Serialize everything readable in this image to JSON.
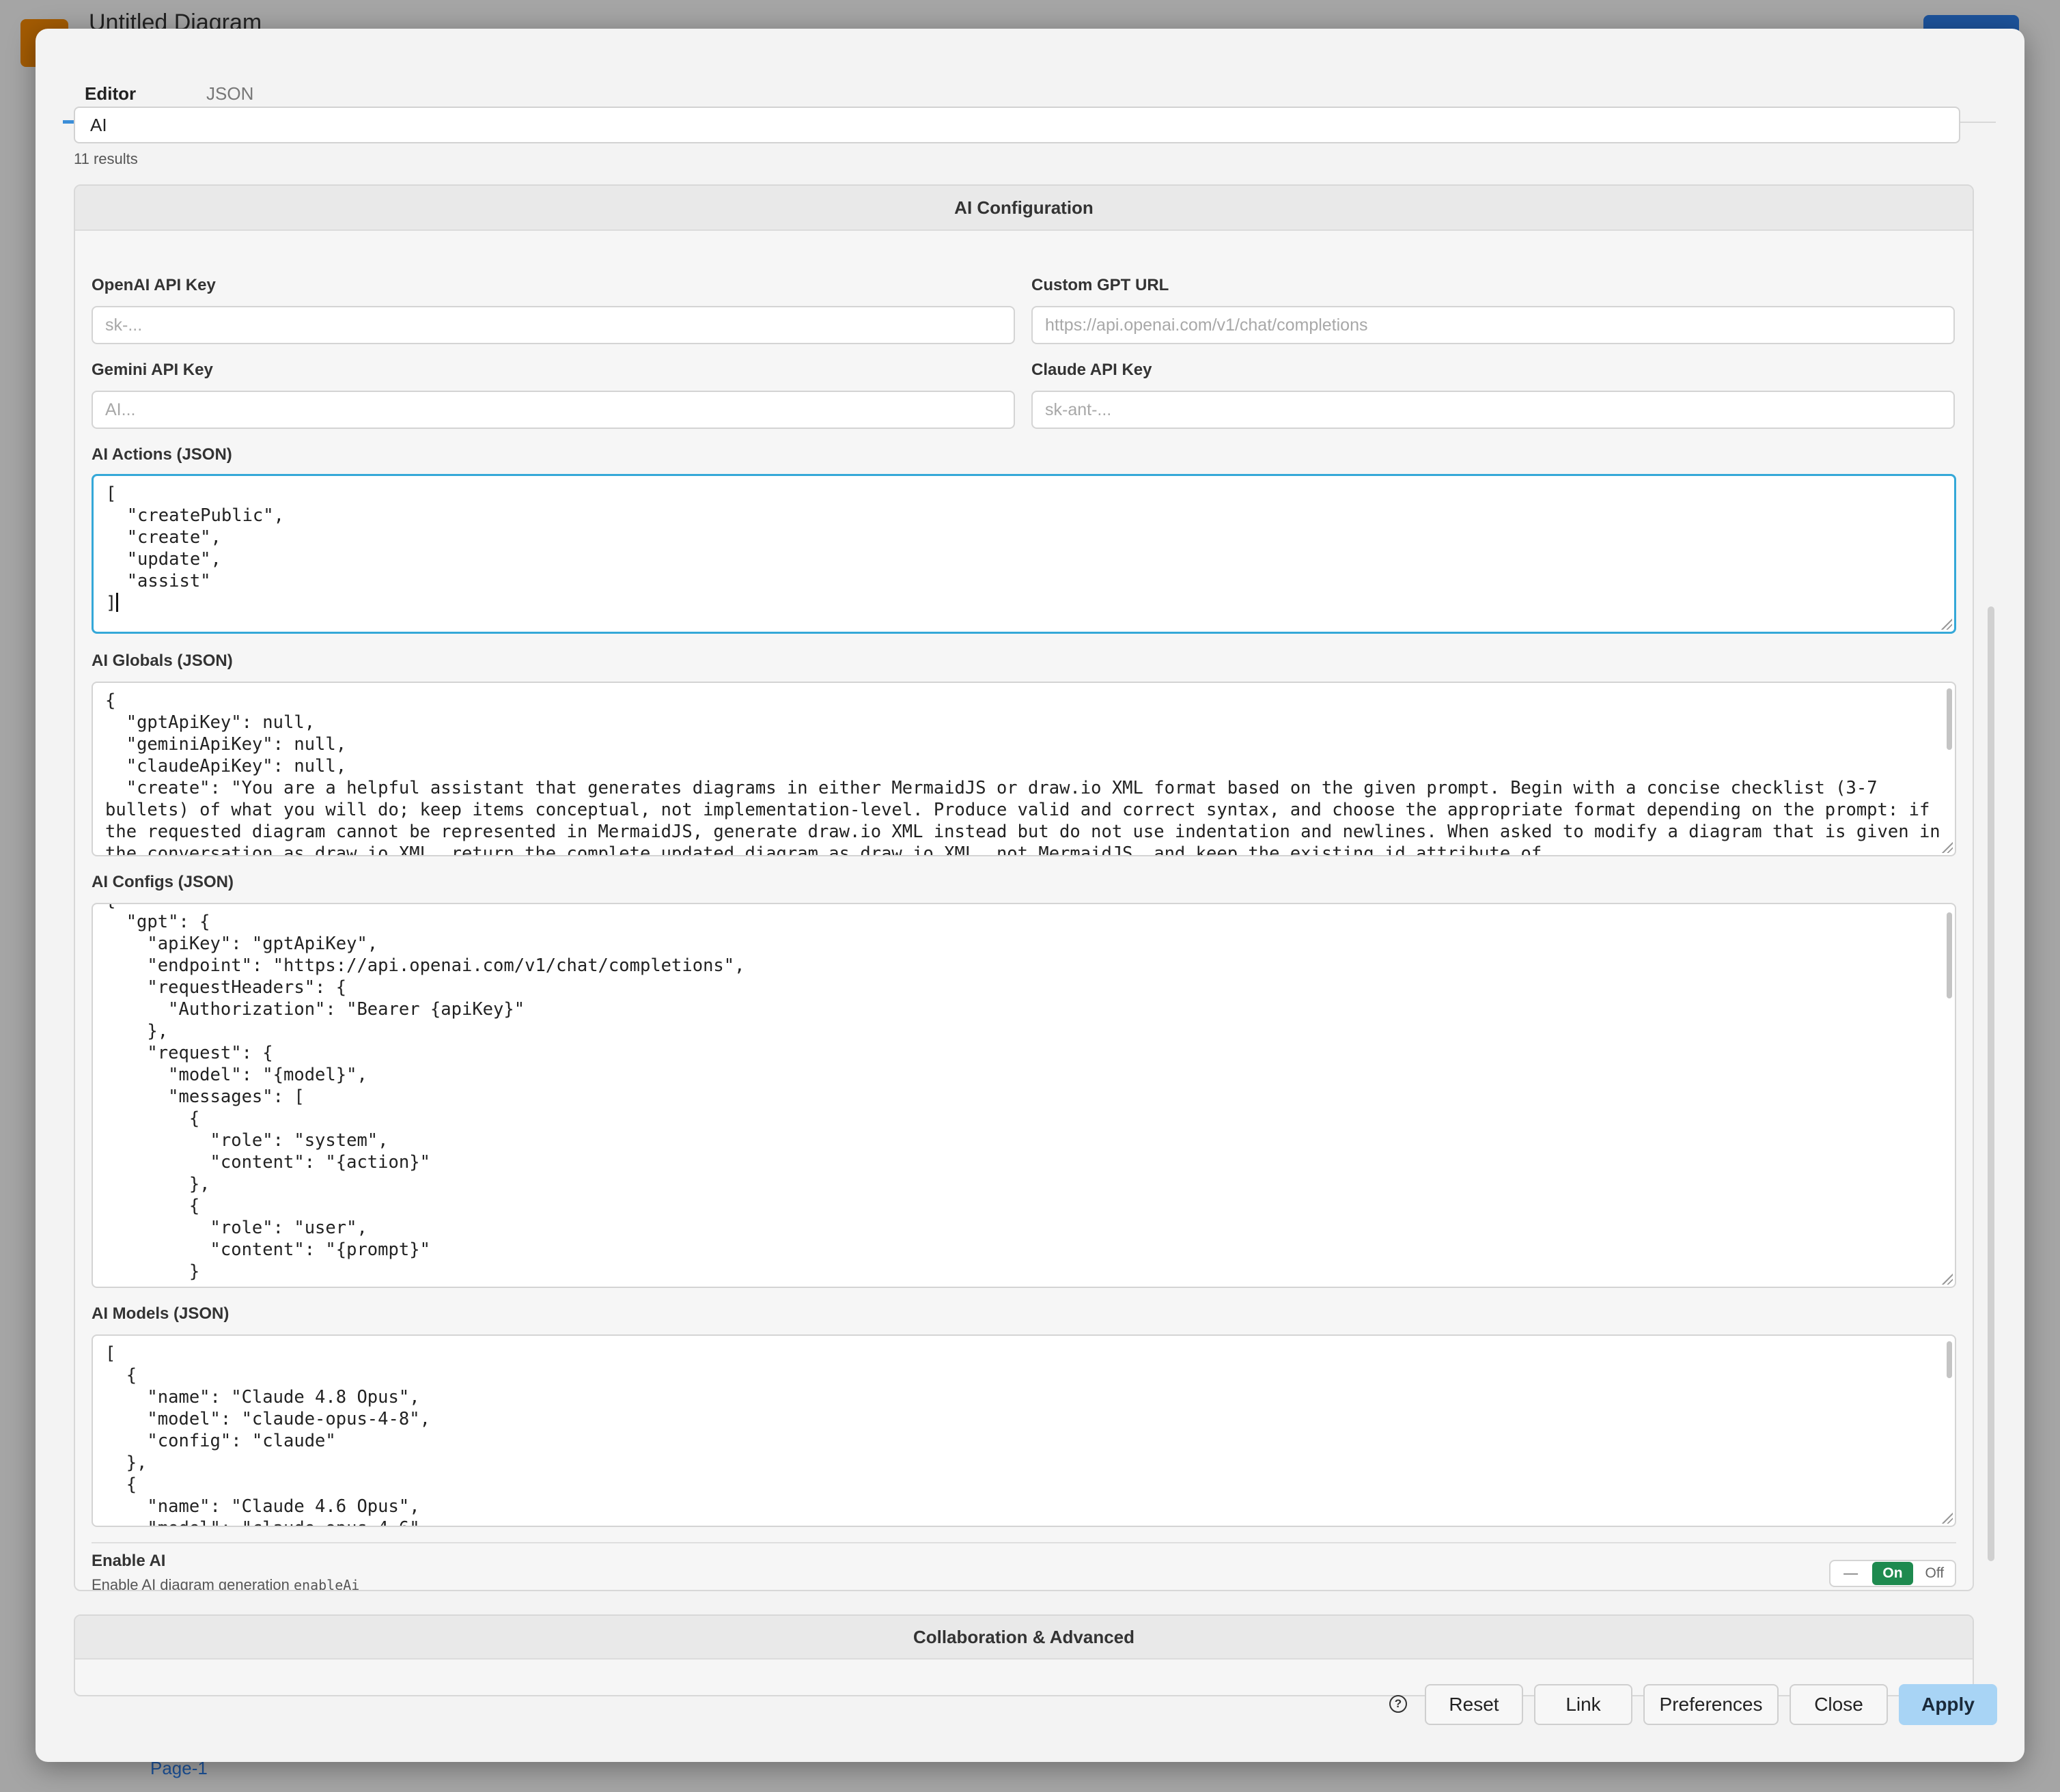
{
  "background": {
    "title": "Untitled Diagram",
    "page_tab": "Page-1"
  },
  "tabs": [
    {
      "label": "Editor",
      "active": true
    },
    {
      "label": "JSON",
      "active": false
    }
  ],
  "search": {
    "value": "AI",
    "results": "11 results"
  },
  "ai_config": {
    "header": "AI Configuration",
    "openai_key": {
      "label": "OpenAI API Key",
      "placeholder": "sk-..."
    },
    "custom_gpt_url": {
      "label": "Custom GPT URL",
      "placeholder": "https://api.openai.com/v1/chat/completions"
    },
    "gemini_key": {
      "label": "Gemini API Key",
      "placeholder": "AI..."
    },
    "claude_key": {
      "label": "Claude API Key",
      "placeholder": "sk-ant-..."
    },
    "actions": {
      "label": "AI Actions (JSON)",
      "value": "[\n  \"createPublic\",\n  \"create\",\n  \"update\",\n  \"assist\"\n]"
    },
    "globals": {
      "label": "AI Globals (JSON)",
      "value": "{\n  \"gptApiKey\": null,\n  \"geminiApiKey\": null,\n  \"claudeApiKey\": null,\n  \"create\": \"You are a helpful assistant that generates diagrams in either MermaidJS or draw.io XML format based on the given prompt. Begin with a concise checklist (3-7 bullets) of what you will do; keep items conceptual, not implementation-level. Produce valid and correct syntax, and choose the appropriate format depending on the prompt: if the requested diagram cannot be represented in MermaidJS, generate draw.io XML instead but do not use indentation and newlines. When asked to modify a diagram that is given in the conversation as draw.io XML, return the complete updated diagram as draw.io XML, not MermaidJS, and keep the existing id attribute of"
    },
    "configs": {
      "label": "AI Configs (JSON)",
      "value": "{\n  \"gpt\": {\n    \"apiKey\": \"gptApiKey\",\n    \"endpoint\": \"https://api.openai.com/v1/chat/completions\",\n    \"requestHeaders\": {\n      \"Authorization\": \"Bearer {apiKey}\"\n    },\n    \"request\": {\n      \"model\": \"{model}\",\n      \"messages\": [\n        {\n          \"role\": \"system\",\n          \"content\": \"{action}\"\n        },\n        {\n          \"role\": \"user\",\n          \"content\": \"{prompt}\"\n        }"
    },
    "models": {
      "label": "AI Models (JSON)",
      "value": "[\n  {\n    \"name\": \"Claude 4.8 Opus\",\n    \"model\": \"claude-opus-4-8\",\n    \"config\": \"claude\"\n  },\n  {\n    \"name\": \"Claude 4.6 Opus\",\n    \"model\": \"claude-opus-4-6\","
    },
    "enable_ai": {
      "title": "Enable AI",
      "description": "Enable AI diagram generation",
      "key": "enableAi",
      "options": [
        "—",
        "On",
        "Off"
      ],
      "selected": "On"
    }
  },
  "collab": {
    "header": "Collaboration & Advanced"
  },
  "footer": {
    "help_glyph": "?",
    "reset": "Reset",
    "link": "Link",
    "preferences": "Preferences",
    "close": "Close",
    "apply": "Apply"
  },
  "colors": {
    "accent": "#3b8ed8",
    "focus_border": "#35a8d8",
    "toggle_on": "#1e8a4f",
    "apply_bg": "#a8d4f5"
  }
}
